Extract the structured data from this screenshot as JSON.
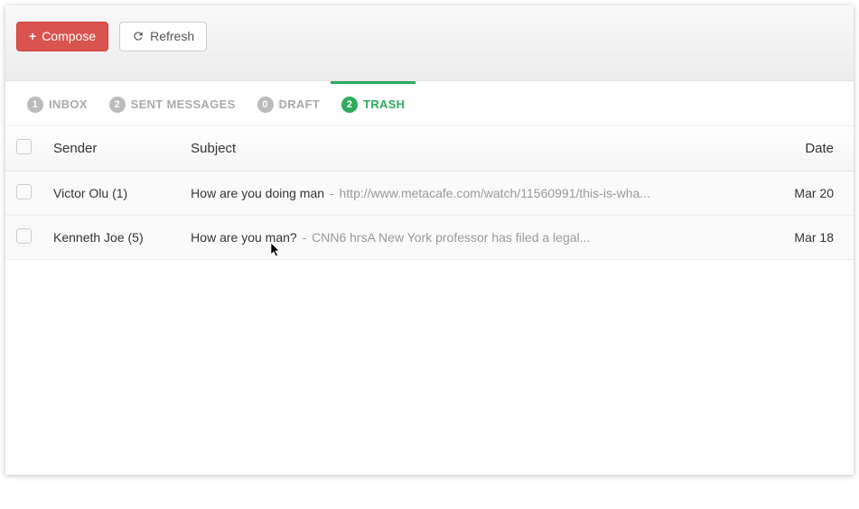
{
  "toolbar": {
    "compose_label": "Compose",
    "refresh_label": "Refresh"
  },
  "tabs": [
    {
      "count": "1",
      "label": "INBOX",
      "active": false
    },
    {
      "count": "2",
      "label": "SENT MESSAGES",
      "active": false
    },
    {
      "count": "0",
      "label": "DRAFT",
      "active": false
    },
    {
      "count": "2",
      "label": "TRASH",
      "active": true
    }
  ],
  "headers": {
    "sender": "Sender",
    "subject": "Subject",
    "date": "Date"
  },
  "rows": [
    {
      "sender": "Victor Olu (1)",
      "subject_title": "How are you doing man",
      "subject_sep": " - ",
      "subject_preview": "http://www.metacafe.com/watch/11560991/this-is-wha...",
      "date": "Mar 20"
    },
    {
      "sender": "Kenneth Joe (5)",
      "subject_title": "How are you man?",
      "subject_sep": " - ",
      "subject_preview": "CNN6 hrsA New York professor has filed a legal...",
      "date": "Mar 18"
    }
  ]
}
